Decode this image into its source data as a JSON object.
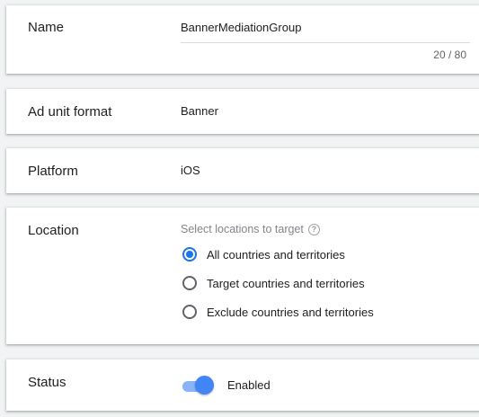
{
  "name_card": {
    "label": "Name",
    "input_value": "BannerMediationGroup",
    "counter": "20 / 80"
  },
  "format_card": {
    "label": "Ad unit format",
    "value": "Banner"
  },
  "platform_card": {
    "label": "Platform",
    "value": "iOS"
  },
  "location_card": {
    "label": "Location",
    "hint": "Select locations to target",
    "help_icon": "?",
    "options": [
      {
        "label": "All countries and territories",
        "selected": true
      },
      {
        "label": "Target countries and territories",
        "selected": false
      },
      {
        "label": "Exclude countries and territories",
        "selected": false
      }
    ]
  },
  "status_card": {
    "label": "Status",
    "toggle_label": "Enabled",
    "enabled": true
  },
  "colors": {
    "accent": "#1a73e8",
    "toggle_thumb": "#4285f4",
    "toggle_track": "#8ab4f8",
    "background": "#f1f3f4"
  }
}
